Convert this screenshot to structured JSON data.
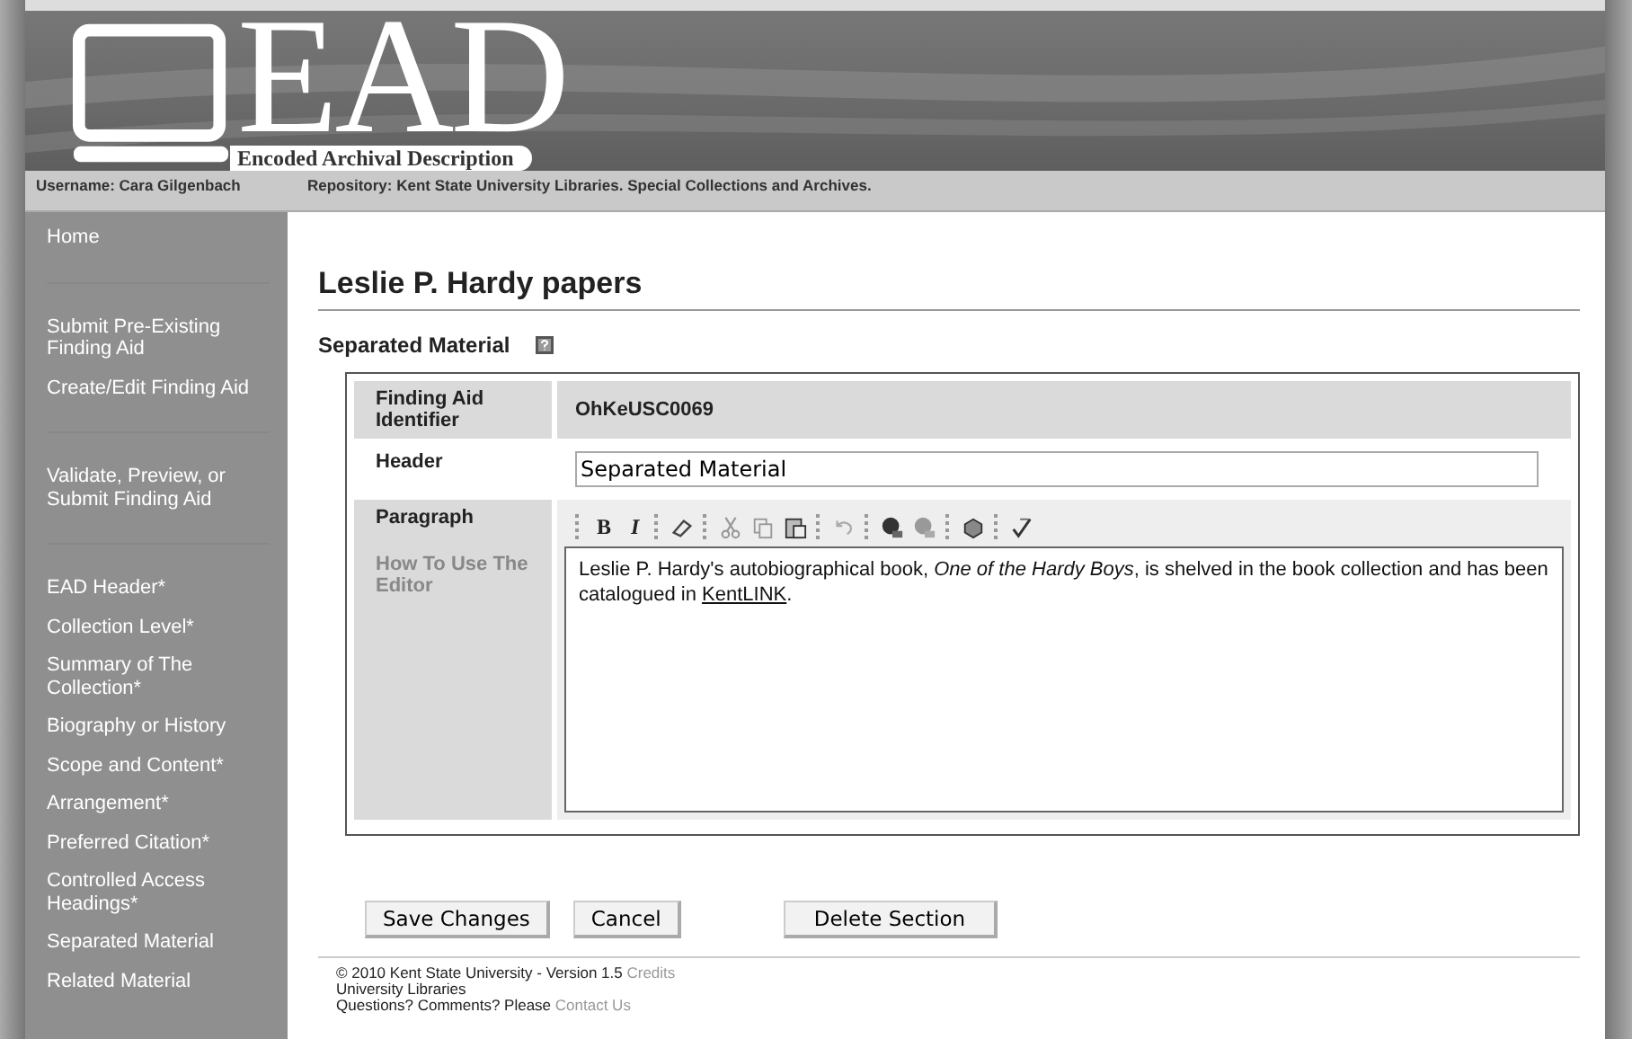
{
  "header": {
    "logo_text": "EAD",
    "logo_subtitle": "Encoded Archival Description",
    "username": "Username: Cara Gilgenbach",
    "repository": "Repository: Kent State University Libraries. Special Collections and Archives."
  },
  "sidebar": {
    "groups": [
      {
        "items": [
          "Home"
        ]
      },
      {
        "items": [
          "Submit Pre-Existing Finding Aid",
          "Create/Edit Finding Aid"
        ]
      },
      {
        "items": [
          "Validate, Preview, or Submit Finding Aid"
        ]
      },
      {
        "items": [
          "EAD Header*",
          "Collection Level*",
          "Summary of The Collection*",
          "Biography or History",
          "Scope and Content*",
          "Arrangement*",
          "Preferred Citation*",
          "Controlled Access Headings*",
          "Separated Material",
          "Related Material"
        ]
      }
    ]
  },
  "page_title": "Leslie P. Hardy papers",
  "section_title": "Separated Material",
  "form": {
    "rows": [
      {
        "kind": "static",
        "label": "Finding Aid Identifier",
        "value": "OhKeUSC0069"
      },
      {
        "kind": "input",
        "label": "Header",
        "value": "Separated Material"
      },
      {
        "kind": "editor",
        "label": "Paragraph",
        "help": "How To Use The Editor",
        "toolbar": [
          "B",
          "I"
        ],
        "text_before": "Leslie P. Hardy's autobiographical book, *One of the Hardy Boys*, is shelved in the book collection and has been catalogued in",
        "link": "KentLINK",
        "text_after": "."
      }
    ]
  },
  "buttons": [
    "Save Changes",
    "Cancel",
    "Delete Section"
  ],
  "footer": {
    "copyright": "© 2010 Kent State University - Version 1.5",
    "credits": "Credits",
    "org": "University Libraries",
    "question": "Questions? Comments? Please",
    "contact": "Contact Us"
  }
}
